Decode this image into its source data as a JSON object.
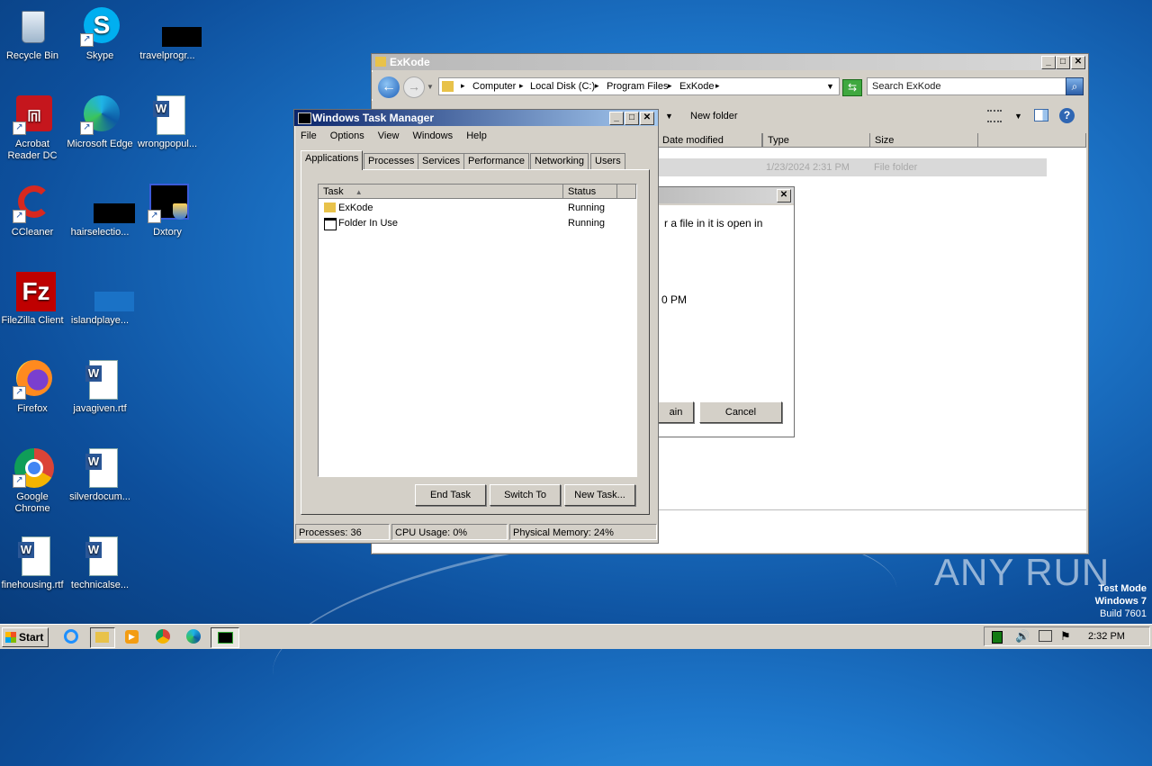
{
  "desktop": {
    "icons": [
      {
        "label": "Recycle Bin",
        "icon": "recycle-bin-icon"
      },
      {
        "label": "Skype",
        "icon": "skype-icon"
      },
      {
        "label": "travelprogr...",
        "icon": "blacked-out-icon"
      },
      {
        "label": "Acrobat Reader DC",
        "icon": "acrobat-icon"
      },
      {
        "label": "Microsoft Edge",
        "icon": "edge-icon"
      },
      {
        "label": "wrongpopul...",
        "icon": "word-doc-icon"
      },
      {
        "label": "CCleaner",
        "icon": "ccleaner-icon"
      },
      {
        "label": "hairselectio...",
        "icon": "blacked-out-icon"
      },
      {
        "label": "Dxtory",
        "icon": "dxtory-icon"
      },
      {
        "label": "FileZilla Client",
        "icon": "filezilla-icon"
      },
      {
        "label": "islandplaye...",
        "icon": "blank-icon"
      },
      {
        "label": "Firefox",
        "icon": "firefox-icon"
      },
      {
        "label": "javagiven.rtf",
        "icon": "word-doc-icon"
      },
      {
        "label": "Google Chrome",
        "icon": "chrome-icon"
      },
      {
        "label": "silverdocum...",
        "icon": "word-doc-icon"
      },
      {
        "label": "finehousing.rtf",
        "icon": "word-doc-icon"
      },
      {
        "label": "technicalse...",
        "icon": "word-doc-icon"
      }
    ],
    "watermark": "ANY RUN",
    "test_mode": [
      "Test Mode",
      "Windows 7",
      "Build 7601"
    ]
  },
  "explorer": {
    "title": "ExKode",
    "breadcrumb": [
      "Computer",
      "Local Disk (C:)",
      "Program Files",
      "ExKode"
    ],
    "search_placeholder": "Search ExKode",
    "new_folder": "New folder",
    "columns": [
      "Date modified",
      "Type",
      "Size"
    ],
    "row": {
      "date": "1/23/2024 2:31 PM",
      "type": "File folder"
    }
  },
  "dialog": {
    "text1": "r a file in it is open in",
    "text2": "0 PM",
    "try_again": "ain",
    "cancel": "Cancel"
  },
  "taskmgr": {
    "title": "Windows Task Manager",
    "menu": [
      "File",
      "Options",
      "View",
      "Windows",
      "Help"
    ],
    "tabs": [
      "Applications",
      "Processes",
      "Services",
      "Performance",
      "Networking",
      "Users"
    ],
    "columns": {
      "task": "Task",
      "status": "Status"
    },
    "tasks": [
      {
        "name": "ExKode",
        "status": "Running"
      },
      {
        "name": "Folder In Use",
        "status": "Running"
      }
    ],
    "buttons": {
      "end_task": "End Task",
      "switch_to": "Switch To",
      "new_task": "New Task..."
    },
    "status": {
      "processes": "Processes: 36",
      "cpu": "CPU Usage: 0%",
      "memory": "Physical Memory: 24%"
    }
  },
  "taskbar": {
    "start": "Start",
    "clock": "2:32 PM"
  }
}
